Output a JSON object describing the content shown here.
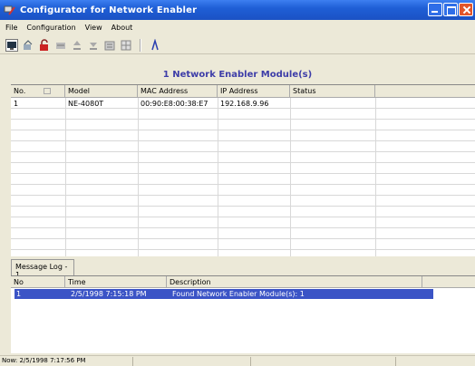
{
  "window": {
    "title": "Configurator for Network Enabler"
  },
  "menu": {
    "items": [
      "File",
      "Configuration",
      "View",
      "About"
    ]
  },
  "toolbar": {
    "icons": [
      "monitor-icon",
      "broadcast-icon",
      "unlock-icon",
      "config-icon",
      "upload-icon",
      "download-icon",
      "settings-icon",
      "grid-icon",
      "wizard-icon"
    ]
  },
  "modules": {
    "header": "1 Network Enabler Module(s)",
    "columns": [
      "No.",
      "Model",
      "MAC Address",
      "IP Address",
      "Status"
    ],
    "rows": [
      {
        "no": "1",
        "model": "NE-4080T",
        "mac": "00:90:E8:00:38:E7",
        "ip": "192.168.9.96",
        "status": ""
      }
    ]
  },
  "message_log": {
    "tab_label": "Message Log - 1",
    "columns": [
      "No",
      "Time",
      "Description"
    ],
    "rows": [
      {
        "no": "1",
        "time": "2/5/1998 7:15:18 PM",
        "description": "Found Network Enabler Module(s): 1"
      }
    ]
  },
  "status_bar": {
    "text": "Now: 2/5/1998 7:17:56 PM"
  },
  "colors": {
    "titlebar": "#1f5fd6",
    "header_text": "#3d3da8",
    "selection": "#3b54c6"
  }
}
